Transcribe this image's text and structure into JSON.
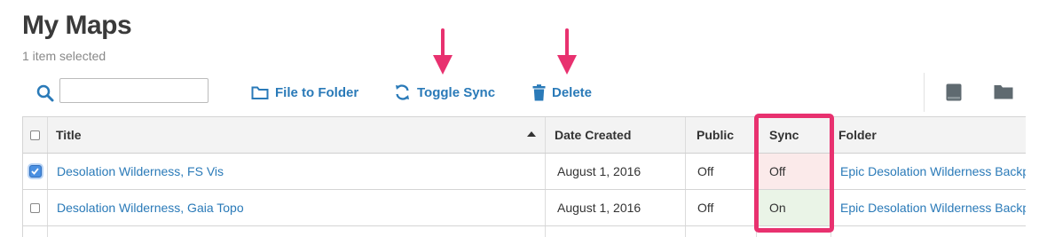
{
  "header": {
    "title": "My Maps",
    "subtitle": "1 item selected"
  },
  "toolbar": {
    "search_placeholder": "",
    "file_to_folder_label": "File to Folder",
    "toggle_sync_label": "Toggle Sync",
    "delete_label": "Delete"
  },
  "table": {
    "columns": {
      "title": "Title",
      "date_created": "Date Created",
      "public": "Public",
      "sync": "Sync",
      "folder": "Folder"
    },
    "sort": {
      "column": "title",
      "direction": "ascending"
    },
    "rows": [
      {
        "selected": true,
        "title": "Desolation Wilderness, FS Vis",
        "date_created": "August 1, 2016",
        "public": "Off",
        "sync": "Off",
        "folder": "Epic Desolation Wilderness Backp"
      },
      {
        "selected": false,
        "title": "Desolation Wilderness, Gaia Topo",
        "date_created": "August 1, 2016",
        "public": "Off",
        "sync": "On",
        "folder": "Epic Desolation Wilderness Backp"
      }
    ]
  },
  "colors": {
    "link": "#2a7ab8",
    "annotation": "#e8316f",
    "sync_off_bg": "#fbeaea",
    "sync_on_bg": "#eaf4e7",
    "checkbox_checked": "#4a90e2"
  },
  "icons": {
    "search": "search-icon",
    "file_to_folder": "folder-outline-icon",
    "toggle_sync": "sync-icon",
    "delete": "trash-icon",
    "book": "book-icon",
    "folder": "folder-icon"
  }
}
